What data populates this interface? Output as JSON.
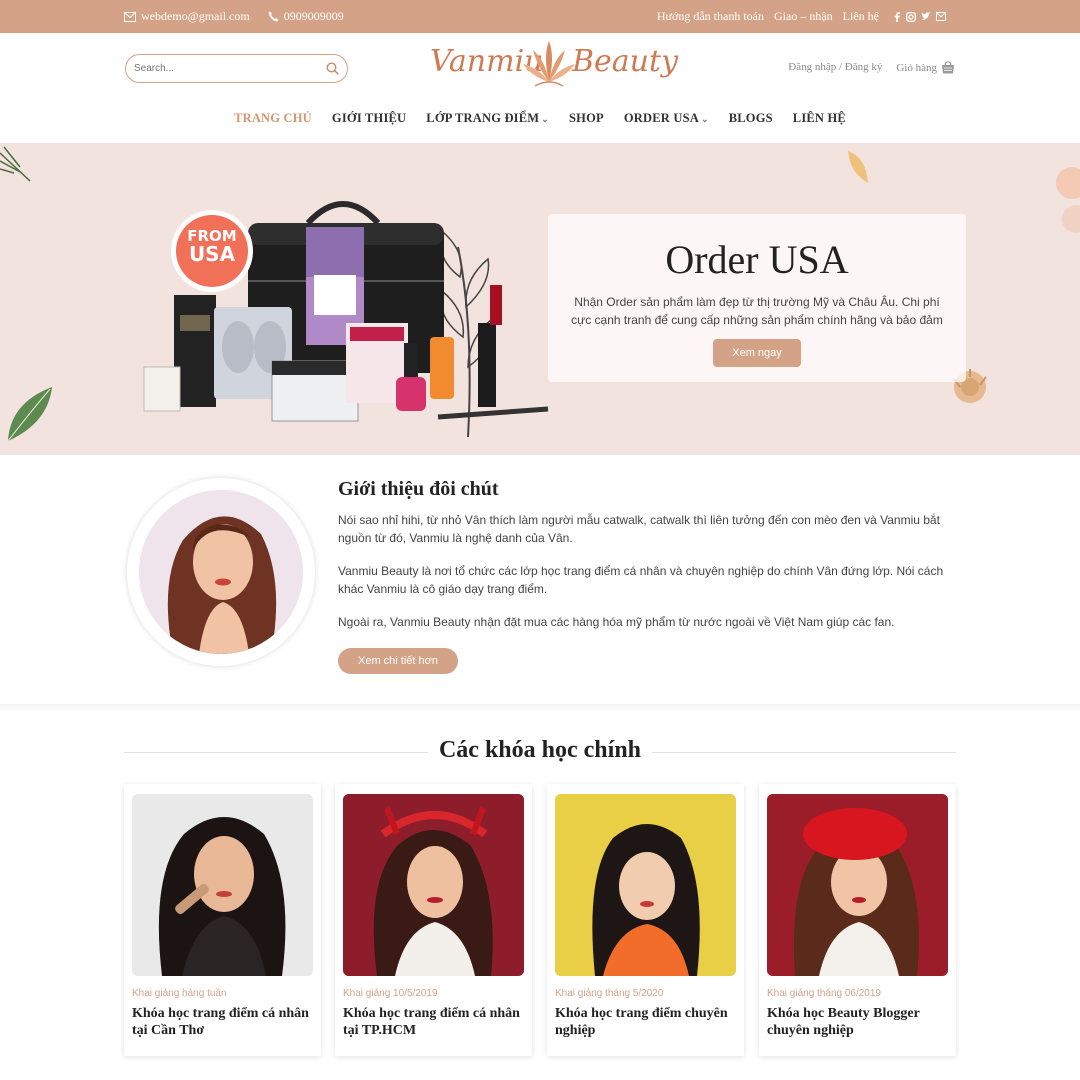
{
  "topbar": {
    "email": "webdemo@gmail.com",
    "phone": "0909009009",
    "links": [
      "Hướng dẫn thanh toán",
      "Giao – nhận",
      "Liên hệ"
    ],
    "social_icons": [
      "facebook-icon",
      "instagram-icon",
      "twitter-icon",
      "email-icon"
    ]
  },
  "header": {
    "search_placeholder": "Search...",
    "logo_left": "Vanmiu",
    "logo_right": "Beauty",
    "login": "Đăng nhập / Đăng ký",
    "cart": "Giỏ hàng"
  },
  "nav": {
    "items": [
      {
        "label": "TRANG CHỦ",
        "active": true
      },
      {
        "label": "GIỚI THIỆU"
      },
      {
        "label": "LỚP TRANG ĐIỂM",
        "dropdown": true
      },
      {
        "label": "SHOP"
      },
      {
        "label": "ORDER USA",
        "dropdown": true
      },
      {
        "label": "BLOGS"
      },
      {
        "label": "LIÊN HỆ"
      }
    ]
  },
  "hero": {
    "badge_line1": "FROM",
    "badge_line2": "USA",
    "title": "Order USA",
    "text": "Nhận Order sản phẩm làm đẹp từ thị trường Mỹ và Châu Âu. Chi phí cực cạnh tranh để cung cấp những sản phẩm chính hãng và bảo đảm",
    "button": "Xem ngay"
  },
  "intro": {
    "title": "Giới thiệu đôi chút",
    "paragraphs": [
      "Nói sao nhỉ hihi, từ nhỏ Vân thích làm người mẫu catwalk, catwalk thì liên tưởng đến con mèo đen và Vanmiu bắt nguồn từ đó, Vanmiu là nghệ danh của Vân.",
      "Vanmiu Beauty là nơi tổ chức các lớp học trang điểm cá nhân và chuyên nghiệp do chính Vân đứng lớp. Nói cách khác Vanmiu là cô giáo dạy trang điểm.",
      "Ngoài ra, Vanmiu Beauty nhận đặt mua các hàng hóa mỹ phẩm từ nước ngoài về Việt Nam giúp các fan."
    ],
    "button": "Xem chi tiết hơn"
  },
  "courses": {
    "title": "Các khóa học chính",
    "items": [
      {
        "date": "Khai giảng hàng tuần",
        "name": "Khóa học trang điểm cá nhân tại Cần Thơ",
        "bg": "#e9e9e9"
      },
      {
        "date": "Khai giảng 10/5/2019",
        "name": "Khóa học trang điểm cá nhân tại TP.HCM",
        "bg": "#8e1d2c"
      },
      {
        "date": "Khai giảng tháng 5/2020",
        "name": "Khóa học trang điểm chuyên nghiệp",
        "bg": "#e8cf45"
      },
      {
        "date": "Khai giảng tháng 06/2019",
        "name": "Khóa học Beauty Blogger chuyên nghiệp",
        "bg": "#9b1d2a"
      }
    ]
  },
  "colors": {
    "accent": "#d4a286",
    "hero_bg": "#f3e3de"
  }
}
